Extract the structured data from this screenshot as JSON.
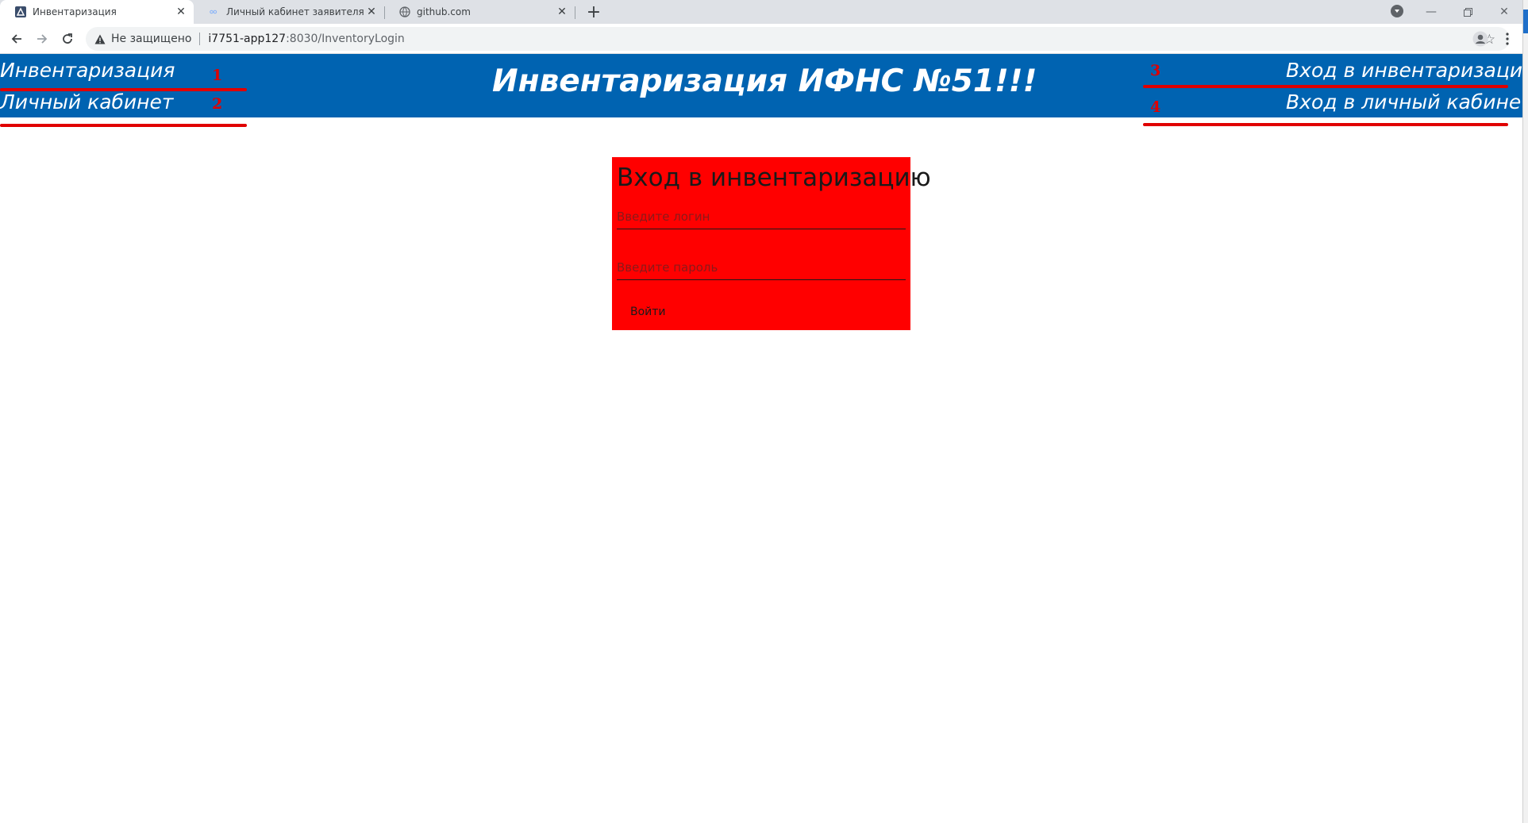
{
  "browser": {
    "tabs": [
      {
        "title": "Инвентаризация",
        "active": true,
        "favicon": "app-favicon"
      },
      {
        "title": "Личный кабинет заявителя",
        "active": false,
        "favicon": "loading-favicon"
      },
      {
        "title": "github.com",
        "active": false,
        "favicon": "globe-icon"
      }
    ],
    "new_tab_label": "+",
    "security_label": "Не защищено",
    "url_host": "i7751-app127",
    "url_path": ":8030/InventoryLogin"
  },
  "header": {
    "nav_inventory": "Инвентаризация",
    "nav_cabinet": "Личный кабинет",
    "title": "Инвентаризация ИФНС №51!!!",
    "login_inventory": "Вход в инвентаризацию",
    "login_cabinet": "Вход в личный кабинет"
  },
  "annotations": {
    "numbers": [
      "1",
      "2",
      "3",
      "4"
    ],
    "color": "#e00000"
  },
  "login_form": {
    "title": "Вход в инвентаризацию",
    "login_placeholder": "Введите логин",
    "password_placeholder": "Введите пароль",
    "submit_label": "Войти"
  },
  "colors": {
    "header_bg": "#0063b1",
    "form_bg": "#ff0000"
  }
}
